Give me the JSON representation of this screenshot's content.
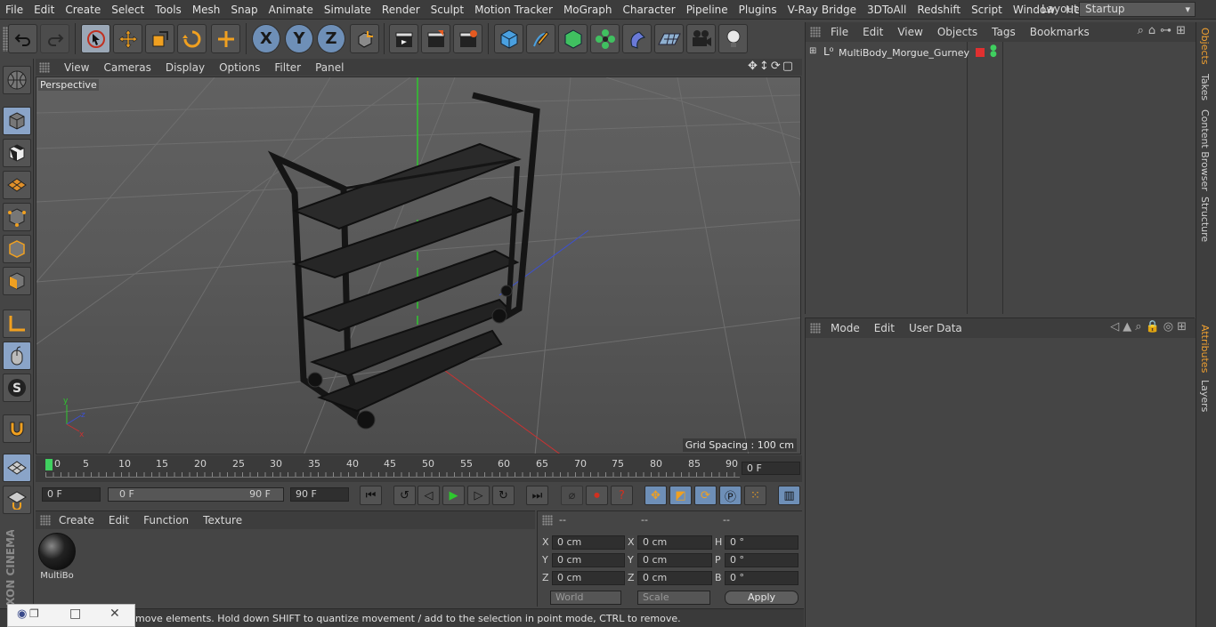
{
  "menubar": {
    "items": [
      "File",
      "Edit",
      "Create",
      "Select",
      "Tools",
      "Mesh",
      "Snap",
      "Animate",
      "Simulate",
      "Render",
      "Sculpt",
      "Motion Tracker",
      "MoGraph",
      "Character",
      "Pipeline",
      "Plugins",
      "V-Ray Bridge",
      "3DToAll",
      "Redshift",
      "Script",
      "Window",
      "Help"
    ],
    "layout_label": "Layout:",
    "layout_value": "Startup"
  },
  "toolbar": {
    "undo_icon": "undo-icon",
    "redo_icon": "redo-icon",
    "axis_x": "X",
    "axis_y": "Y",
    "axis_z": "Z"
  },
  "viewport": {
    "menu": [
      "View",
      "Cameras",
      "Display",
      "Options",
      "Filter",
      "Panel"
    ],
    "label": "Perspective",
    "grid_spacing": "Grid Spacing : 100 cm"
  },
  "timeline": {
    "ticks": [
      "0",
      "5",
      "10",
      "15",
      "20",
      "25",
      "30",
      "35",
      "40",
      "45",
      "50",
      "55",
      "60",
      "65",
      "70",
      "75",
      "80",
      "85",
      "90"
    ],
    "current_frame": "0 F"
  },
  "transport": {
    "start_field": "0 F",
    "range_start": "0 F",
    "range_end": "90 F",
    "end_field": "90 F"
  },
  "materials": {
    "menu": [
      "Create",
      "Edit",
      "Function",
      "Texture"
    ],
    "item_label": "MultiBo"
  },
  "coordinates": {
    "headers": [
      "--",
      "--",
      "--"
    ],
    "rows": [
      {
        "l1": "X",
        "v1": "0 cm",
        "l2": "X",
        "v2": "0 cm",
        "l3": "H",
        "v3": "0 °"
      },
      {
        "l1": "Y",
        "v1": "0 cm",
        "l2": "Y",
        "v2": "0 cm",
        "l3": "P",
        "v3": "0 °"
      },
      {
        "l1": "Z",
        "v1": "0 cm",
        "l2": "Z",
        "v2": "0 cm",
        "l3": "B",
        "v3": "0 °"
      }
    ],
    "space_select": "World",
    "mode_select": "Scale",
    "apply_label": "Apply"
  },
  "status": {
    "text": "move elements. Hold down SHIFT to quantize movement / add to the selection in point mode, CTRL to remove."
  },
  "objects": {
    "menu": [
      "File",
      "Edit",
      "View",
      "Objects",
      "Tags",
      "Bookmarks"
    ],
    "items": [
      {
        "name": "MultiBody_Morgue_Gurney"
      }
    ]
  },
  "attributes": {
    "menu": [
      "Mode",
      "Edit",
      "User Data"
    ]
  },
  "sidetabs": {
    "top": [
      "Objects",
      "Takes",
      "Content Browser",
      "Structure"
    ],
    "bottom": [
      "Attributes",
      "Layers"
    ]
  },
  "brand": {
    "vertical": "MAXON CINEMA 4D"
  },
  "colors": {
    "accent": "#f0a030",
    "selected_tool": "#8aa4c8",
    "axis_x": "#c83232",
    "axis_y": "#2ec82e",
    "axis_z": "#3c50d2"
  }
}
